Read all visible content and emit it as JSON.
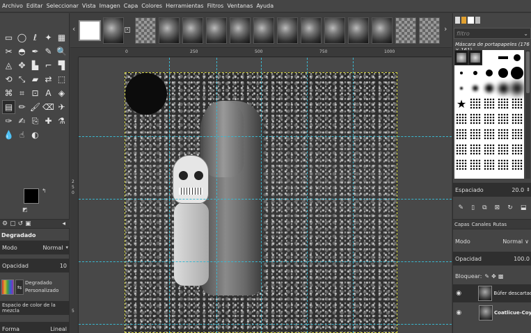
{
  "menu": [
    "Archivo",
    "Editar",
    "Seleccionar",
    "Vista",
    "Imagen",
    "Capa",
    "Colores",
    "Herramientas",
    "Filtros",
    "Ventanas",
    "Ayuda"
  ],
  "tools": [
    {
      "name": "rect-select-tool",
      "glyph": "▭"
    },
    {
      "name": "ellipse-select-tool",
      "glyph": "◯"
    },
    {
      "name": "free-select-tool",
      "glyph": "ℓ"
    },
    {
      "name": "fuzzy-select-tool",
      "glyph": "✦"
    },
    {
      "name": "by-color-select-tool",
      "glyph": "▦"
    },
    {
      "name": "scissors-tool",
      "glyph": "✂"
    },
    {
      "name": "foreground-select-tool",
      "glyph": "◓"
    },
    {
      "name": "paths-tool",
      "glyph": "✒"
    },
    {
      "name": "color-picker-tool",
      "glyph": "✎"
    },
    {
      "name": "zoom-tool",
      "glyph": "🔍"
    },
    {
      "name": "measure-tool",
      "glyph": "◬"
    },
    {
      "name": "move-tool",
      "glyph": "✥"
    },
    {
      "name": "align-tool",
      "glyph": "▙"
    },
    {
      "name": "crop-tool",
      "glyph": "⌐"
    },
    {
      "name": "unified-transform-tool",
      "glyph": "▜"
    },
    {
      "name": "rotate-tool",
      "glyph": "⟲"
    },
    {
      "name": "scale-tool",
      "glyph": "⤡"
    },
    {
      "name": "shear-tool",
      "glyph": "▰"
    },
    {
      "name": "flip-tool",
      "glyph": "⇄"
    },
    {
      "name": "perspective-tool",
      "glyph": "⬚"
    },
    {
      "name": "cage-tool",
      "glyph": "⌘"
    },
    {
      "name": "warp-tool",
      "glyph": "⌗"
    },
    {
      "name": "handle-transform-tool",
      "glyph": "⊡"
    },
    {
      "name": "text-tool",
      "glyph": "A"
    },
    {
      "name": "bucket-fill-tool",
      "glyph": "◈"
    },
    {
      "name": "gradient-tool",
      "glyph": "▤",
      "active": true
    },
    {
      "name": "pencil-tool",
      "glyph": "✏"
    },
    {
      "name": "paintbrush-tool",
      "glyph": "🖌"
    },
    {
      "name": "eraser-tool",
      "glyph": "⌫"
    },
    {
      "name": "airbrush-tool",
      "glyph": "✈"
    },
    {
      "name": "ink-tool",
      "glyph": "✑"
    },
    {
      "name": "mypaint-brush-tool",
      "glyph": "✍"
    },
    {
      "name": "clone-tool",
      "glyph": "⎘"
    },
    {
      "name": "heal-tool",
      "glyph": "✚"
    },
    {
      "name": "perspective-clone-tool",
      "glyph": "⚗"
    },
    {
      "name": "blur-tool",
      "glyph": "💧"
    },
    {
      "name": "smudge-tool",
      "glyph": "☝"
    },
    {
      "name": "dodge-burn-tool",
      "glyph": "◐"
    }
  ],
  "toolOptions": {
    "title": "Degradado",
    "mode_label": "Modo",
    "mode_value": "Normal",
    "opacity_label": "Opacidad",
    "opacity_value": "10",
    "gradient_line1": "Degradado",
    "gradient_line2": "Personalizado",
    "colorspace_label": "Espacio de color de la mezcla",
    "shape_label": "Forma",
    "shape_value": "Lineal"
  },
  "rulers": {
    "top": [
      "0",
      "250",
      "500",
      "750",
      "1000"
    ],
    "left": [
      "2",
      "5",
      "0",
      "5"
    ]
  },
  "brushes": {
    "title": "Máscara de portapapeles (176 × 161)",
    "spacing_label": "Espaciado",
    "spacing_value": "20.0"
  },
  "layers": {
    "tab_layers": "Capas",
    "tab_channels": "Canales",
    "tab_paths": "Rutas",
    "mode_label": "Modo",
    "mode_value": "Normal",
    "opacity_label": "Opacidad",
    "opacity_value": "100.0",
    "lock_label": "Bloquear:",
    "items": [
      {
        "name": "Búfer descartado"
      },
      {
        "name": "Coatlicue-Coyo"
      }
    ]
  },
  "filter_placeholder": "filtro"
}
